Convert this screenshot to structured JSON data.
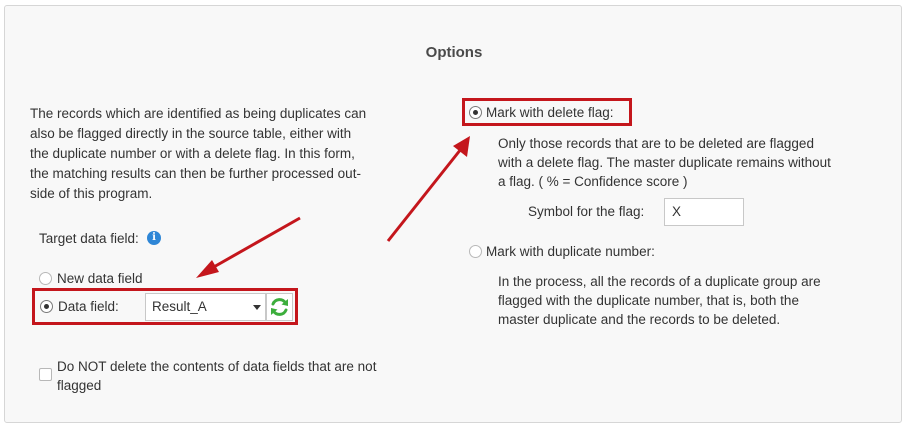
{
  "title": "Options",
  "intro_lines": [
    "The records which are identified as being duplicates can",
    "also be flagged directly in the source table, either with",
    "the duplicate number or with a delete flag. In this form,",
    "the matching results can then be further processed out-",
    "side of this program."
  ],
  "target": {
    "label": "Target data field:",
    "info_icon": "info-icon",
    "new_field_label": "New data field",
    "new_field_selected": false,
    "data_field_label": "Data field:",
    "data_field_selected": true,
    "data_field_value": "Result_A",
    "refresh_icon": "refresh-icon"
  },
  "no_delete": {
    "lines": [
      "Do NOT delete the contents of data fields that are not",
      "flagged"
    ],
    "checked": false
  },
  "mark_delete": {
    "label": "Mark with delete flag:",
    "selected": true,
    "desc_lines": [
      "Only those records that are to be deleted are flagged",
      "with a delete flag. The master duplicate remains without",
      "a flag. ( % = Confidence score )"
    ],
    "symbol_label": "Symbol for the flag:",
    "symbol_value": "X"
  },
  "mark_dup": {
    "label": "Mark with duplicate number:",
    "selected": false,
    "desc_lines": [
      "In the process, all the records of a duplicate group are",
      "flagged with the duplicate number, that is, both the",
      "master duplicate and the records to be deleted."
    ]
  },
  "colors": {
    "annotation": "#c4161c",
    "panel": "#f8f8f8",
    "info": "#2e86d6",
    "refresh": "#3cae3c"
  }
}
